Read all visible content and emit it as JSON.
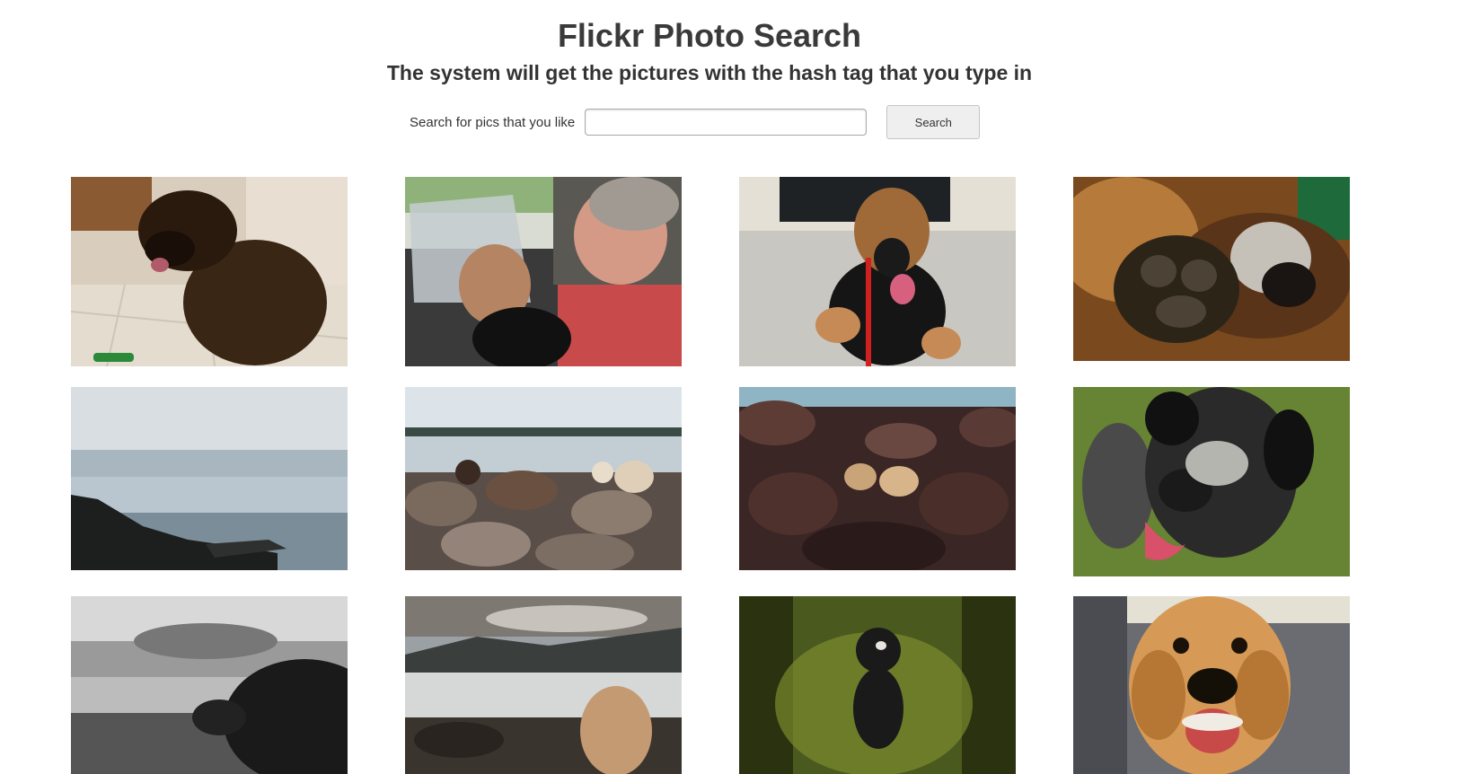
{
  "header": {
    "title": "Flickr Photo Search",
    "subtitle": "The system will get the pictures with the hash tag that you type in"
  },
  "search": {
    "label": "Search for pics that you like",
    "value": "",
    "placeholder": "",
    "button_label": "Search"
  },
  "photos": [
    {
      "subject": "german shepherd puppy in kitchen"
    },
    {
      "subject": "man with dog wearing cone in car"
    },
    {
      "subject": "german shepherd puppy sitting with red leash"
    },
    {
      "subject": "close-up dog paw"
    },
    {
      "subject": "cloudy seaside cliffs"
    },
    {
      "subject": "dogs on rocky beach with person"
    },
    {
      "subject": "two dogs on volcanic rocks"
    },
    {
      "subject": "spotted dog smiling on grass"
    },
    {
      "subject": "black and white dog on rocky shore"
    },
    {
      "subject": "fluffy dog on rocky shore at sunset"
    },
    {
      "subject": "black poodle running in forest"
    },
    {
      "subject": "golden retriever close-up"
    }
  ]
}
